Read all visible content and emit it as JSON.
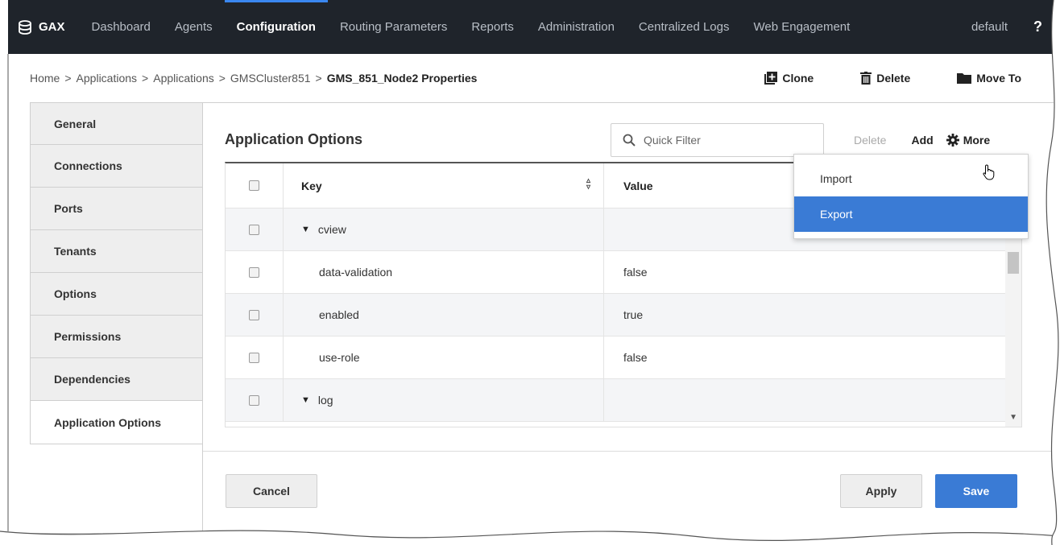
{
  "nav": {
    "brand": "GAX",
    "items": [
      {
        "label": "Dashboard",
        "active": false
      },
      {
        "label": "Agents",
        "active": false
      },
      {
        "label": "Configuration",
        "active": true
      },
      {
        "label": "Routing Parameters",
        "active": false
      },
      {
        "label": "Reports",
        "active": false
      },
      {
        "label": "Administration",
        "active": false
      },
      {
        "label": "Centralized Logs",
        "active": false
      },
      {
        "label": "Web Engagement",
        "active": false
      }
    ],
    "tenant": "default",
    "help": "?"
  },
  "breadcrumb": {
    "items": [
      "Home",
      "Applications",
      "Applications",
      "GMSCluster851"
    ],
    "separator": ">",
    "current": "GMS_851_Node2 Properties"
  },
  "page_actions": {
    "clone": "Clone",
    "delete": "Delete",
    "move_to": "Move To"
  },
  "tabs": [
    {
      "label": "General",
      "selected": false
    },
    {
      "label": "Connections",
      "selected": false
    },
    {
      "label": "Ports",
      "selected": false
    },
    {
      "label": "Tenants",
      "selected": false
    },
    {
      "label": "Options",
      "selected": false
    },
    {
      "label": "Permissions",
      "selected": false
    },
    {
      "label": "Dependencies",
      "selected": false
    },
    {
      "label": "Application Options",
      "selected": true
    }
  ],
  "panel": {
    "title": "Application Options",
    "filter_placeholder": "Quick Filter",
    "delete": "Delete",
    "add": "Add",
    "more": "More"
  },
  "table": {
    "columns": {
      "key": "Key",
      "value": "Value"
    },
    "rows": [
      {
        "type": "group",
        "key": "cview",
        "value": ""
      },
      {
        "type": "item",
        "key": "data-validation",
        "value": "false"
      },
      {
        "type": "item",
        "key": "enabled",
        "value": "true"
      },
      {
        "type": "item",
        "key": "use-role",
        "value": "false"
      },
      {
        "type": "group",
        "key": "log",
        "value": ""
      }
    ]
  },
  "dropdown": {
    "items": [
      {
        "label": "Import",
        "highlighted": false
      },
      {
        "label": "Export",
        "highlighted": true
      }
    ]
  },
  "footer": {
    "cancel": "Cancel",
    "apply": "Apply",
    "save": "Save"
  },
  "colors": {
    "nav_bg": "#1f242b",
    "accent": "#3a7bd5",
    "nav_active_bar": "#3a87f0"
  }
}
